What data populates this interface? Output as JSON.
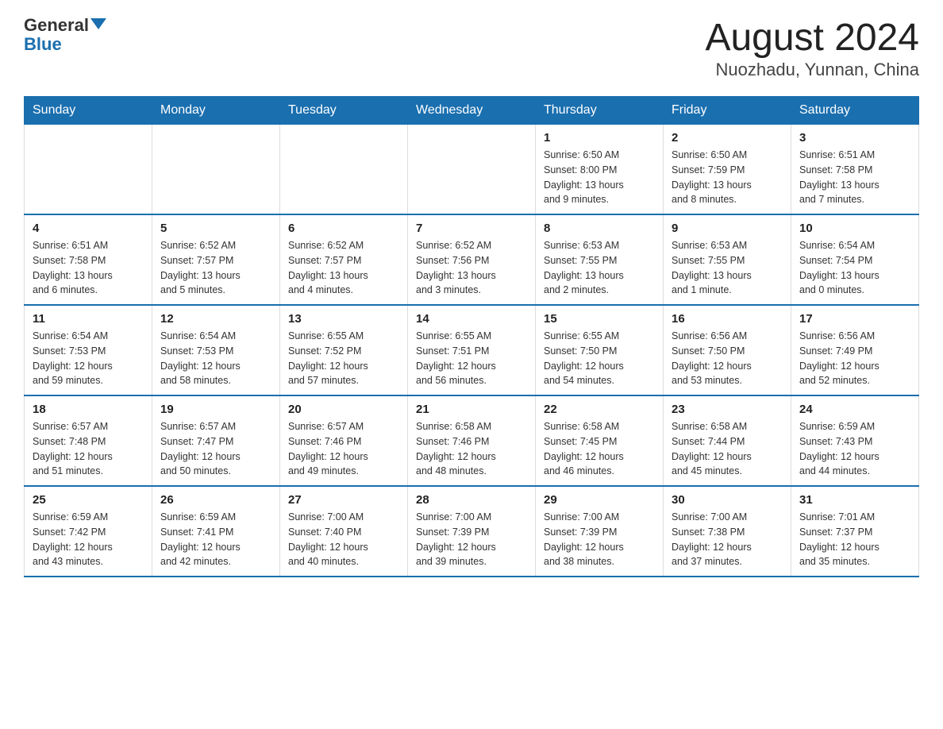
{
  "header": {
    "logo_general": "General",
    "logo_blue": "Blue",
    "title": "August 2024",
    "subtitle": "Nuozhadu, Yunnan, China"
  },
  "weekdays": [
    "Sunday",
    "Monday",
    "Tuesday",
    "Wednesday",
    "Thursday",
    "Friday",
    "Saturday"
  ],
  "weeks": [
    [
      {
        "day": "",
        "info": ""
      },
      {
        "day": "",
        "info": ""
      },
      {
        "day": "",
        "info": ""
      },
      {
        "day": "",
        "info": ""
      },
      {
        "day": "1",
        "info": "Sunrise: 6:50 AM\nSunset: 8:00 PM\nDaylight: 13 hours\nand 9 minutes."
      },
      {
        "day": "2",
        "info": "Sunrise: 6:50 AM\nSunset: 7:59 PM\nDaylight: 13 hours\nand 8 minutes."
      },
      {
        "day": "3",
        "info": "Sunrise: 6:51 AM\nSunset: 7:58 PM\nDaylight: 13 hours\nand 7 minutes."
      }
    ],
    [
      {
        "day": "4",
        "info": "Sunrise: 6:51 AM\nSunset: 7:58 PM\nDaylight: 13 hours\nand 6 minutes."
      },
      {
        "day": "5",
        "info": "Sunrise: 6:52 AM\nSunset: 7:57 PM\nDaylight: 13 hours\nand 5 minutes."
      },
      {
        "day": "6",
        "info": "Sunrise: 6:52 AM\nSunset: 7:57 PM\nDaylight: 13 hours\nand 4 minutes."
      },
      {
        "day": "7",
        "info": "Sunrise: 6:52 AM\nSunset: 7:56 PM\nDaylight: 13 hours\nand 3 minutes."
      },
      {
        "day": "8",
        "info": "Sunrise: 6:53 AM\nSunset: 7:55 PM\nDaylight: 13 hours\nand 2 minutes."
      },
      {
        "day": "9",
        "info": "Sunrise: 6:53 AM\nSunset: 7:55 PM\nDaylight: 13 hours\nand 1 minute."
      },
      {
        "day": "10",
        "info": "Sunrise: 6:54 AM\nSunset: 7:54 PM\nDaylight: 13 hours\nand 0 minutes."
      }
    ],
    [
      {
        "day": "11",
        "info": "Sunrise: 6:54 AM\nSunset: 7:53 PM\nDaylight: 12 hours\nand 59 minutes."
      },
      {
        "day": "12",
        "info": "Sunrise: 6:54 AM\nSunset: 7:53 PM\nDaylight: 12 hours\nand 58 minutes."
      },
      {
        "day": "13",
        "info": "Sunrise: 6:55 AM\nSunset: 7:52 PM\nDaylight: 12 hours\nand 57 minutes."
      },
      {
        "day": "14",
        "info": "Sunrise: 6:55 AM\nSunset: 7:51 PM\nDaylight: 12 hours\nand 56 minutes."
      },
      {
        "day": "15",
        "info": "Sunrise: 6:55 AM\nSunset: 7:50 PM\nDaylight: 12 hours\nand 54 minutes."
      },
      {
        "day": "16",
        "info": "Sunrise: 6:56 AM\nSunset: 7:50 PM\nDaylight: 12 hours\nand 53 minutes."
      },
      {
        "day": "17",
        "info": "Sunrise: 6:56 AM\nSunset: 7:49 PM\nDaylight: 12 hours\nand 52 minutes."
      }
    ],
    [
      {
        "day": "18",
        "info": "Sunrise: 6:57 AM\nSunset: 7:48 PM\nDaylight: 12 hours\nand 51 minutes."
      },
      {
        "day": "19",
        "info": "Sunrise: 6:57 AM\nSunset: 7:47 PM\nDaylight: 12 hours\nand 50 minutes."
      },
      {
        "day": "20",
        "info": "Sunrise: 6:57 AM\nSunset: 7:46 PM\nDaylight: 12 hours\nand 49 minutes."
      },
      {
        "day": "21",
        "info": "Sunrise: 6:58 AM\nSunset: 7:46 PM\nDaylight: 12 hours\nand 48 minutes."
      },
      {
        "day": "22",
        "info": "Sunrise: 6:58 AM\nSunset: 7:45 PM\nDaylight: 12 hours\nand 46 minutes."
      },
      {
        "day": "23",
        "info": "Sunrise: 6:58 AM\nSunset: 7:44 PM\nDaylight: 12 hours\nand 45 minutes."
      },
      {
        "day": "24",
        "info": "Sunrise: 6:59 AM\nSunset: 7:43 PM\nDaylight: 12 hours\nand 44 minutes."
      }
    ],
    [
      {
        "day": "25",
        "info": "Sunrise: 6:59 AM\nSunset: 7:42 PM\nDaylight: 12 hours\nand 43 minutes."
      },
      {
        "day": "26",
        "info": "Sunrise: 6:59 AM\nSunset: 7:41 PM\nDaylight: 12 hours\nand 42 minutes."
      },
      {
        "day": "27",
        "info": "Sunrise: 7:00 AM\nSunset: 7:40 PM\nDaylight: 12 hours\nand 40 minutes."
      },
      {
        "day": "28",
        "info": "Sunrise: 7:00 AM\nSunset: 7:39 PM\nDaylight: 12 hours\nand 39 minutes."
      },
      {
        "day": "29",
        "info": "Sunrise: 7:00 AM\nSunset: 7:39 PM\nDaylight: 12 hours\nand 38 minutes."
      },
      {
        "day": "30",
        "info": "Sunrise: 7:00 AM\nSunset: 7:38 PM\nDaylight: 12 hours\nand 37 minutes."
      },
      {
        "day": "31",
        "info": "Sunrise: 7:01 AM\nSunset: 7:37 PM\nDaylight: 12 hours\nand 35 minutes."
      }
    ]
  ]
}
